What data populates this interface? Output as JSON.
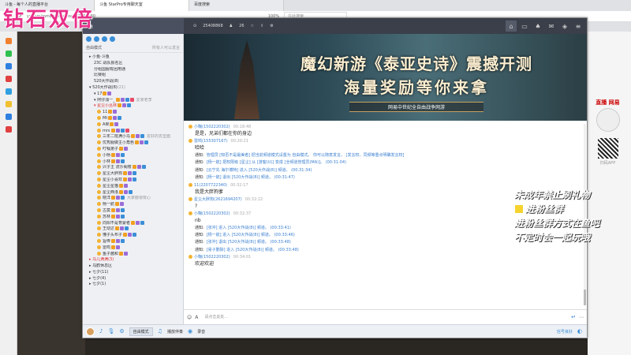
{
  "browser": {
    "tabs": [
      "斗鱼 - 每个人的直播平台",
      "斗鱼 StarPro专用聊天室",
      "百度搜索"
    ],
    "url": "yy.com/mmi/pub/cc/room/2534860",
    "zoom": "100%",
    "search_placeholder": "在此搜索"
  },
  "logo_text": "钻石双倍",
  "app": {
    "room_label": "斗鱼",
    "room_id": "25408868",
    "online_count": "26",
    "titlebar_icons": [
      "home-icon",
      "chat-icon",
      "game-icon",
      "gift-icon",
      "dice-icon",
      "menu-icon"
    ]
  },
  "sidebar": {
    "mode_label": "自由模式",
    "mode_right": "所有人可以发言",
    "channels": [
      {
        "text": "▸ 小鱼·斗鱼",
        "level": 1
      },
      {
        "text": "23C 战队报名区",
        "level": 2
      },
      {
        "text": "分组国服有团用通",
        "level": 2
      },
      {
        "text": "比赛组",
        "level": 2
      },
      {
        "text": "520大作战(8)",
        "level": 2
      },
      {
        "text": "▾ 520大作战(8)",
        "level": 1,
        "count": "(21)"
      },
      {
        "text": "▾ 17",
        "level": 2,
        "tags": 2
      },
      {
        "text": "▾ 阿仔浊一_",
        "level": 2,
        "tags": 4,
        "suffix": "友家老李"
      },
      {
        "text": "▾ 星尘小丛林",
        "level": 2,
        "tags": 3,
        "red": true
      },
      {
        "text": "11",
        "level": 3,
        "tags": 2
      },
      {
        "text": "Mt",
        "level": 3,
        "tags": 3
      },
      {
        "text": "A果",
        "level": 3,
        "tags": 2
      },
      {
        "text": "mrs",
        "level": 3,
        "tags": 4
      },
      {
        "text": "三年二班满小马",
        "level": 3,
        "tags": 3,
        "suffix": "友好的去里面"
      },
      {
        "text": "优秀服做主小角色",
        "level": 3,
        "tags": 3
      },
      {
        "text": "叮嘱弟子",
        "level": 3,
        "tags": 2
      },
      {
        "text": "小杨",
        "level": 3,
        "tags": 3
      },
      {
        "text": "小林",
        "level": 3,
        "tags": 3
      },
      {
        "text": "兴子主 流沙阁楼",
        "level": 3,
        "tags": 3
      },
      {
        "text": "星尘大胖狗",
        "level": 3,
        "tags": 3
      },
      {
        "text": "星尘小喜欢",
        "level": 3,
        "tags": 3
      },
      {
        "text": "星尘星猫",
        "level": 3,
        "tags": 2
      },
      {
        "text": "星尘西洛",
        "level": 3,
        "tags": 3
      },
      {
        "text": "晓洋",
        "level": 3,
        "tags": 3,
        "suffix": "大家都很有心"
      },
      {
        "text": "杨一航",
        "level": 3,
        "tags": 2
      },
      {
        "text": "古莫",
        "level": 3,
        "tags": 3
      },
      {
        "text": "苏林",
        "level": 3,
        "tags": 3
      },
      {
        "text": "向阳不是育蒙者",
        "level": 3,
        "tags": 3
      },
      {
        "text": "王动达",
        "level": 3,
        "tags": 3
      },
      {
        "text": "懂子头布子",
        "level": 3,
        "tags": 3
      },
      {
        "text": "旨俸",
        "level": 3,
        "tags": 3
      },
      {
        "text": "雷鸣",
        "level": 3,
        "tags": 2
      },
      {
        "text": "鱼子酱和",
        "level": 3,
        "tags": 2
      },
      {
        "text": "▸ 马儿满满(3)",
        "level": 1,
        "red": true
      },
      {
        "text": "▸ 乌鹤休息区",
        "level": 1
      },
      {
        "text": "▸ 七夕(11)",
        "level": 1
      },
      {
        "text": "▸ 七夕(4)",
        "level": 1
      },
      {
        "text": "▸ 七夕(1)",
        "level": 1
      }
    ]
  },
  "banner": {
    "line1": "魔幻新游《泰亚史诗》震撼开测",
    "line2": "海量奖励等你来拿",
    "line3": "网易中世纪全自由战争网游"
  },
  "chat": {
    "messages": [
      {
        "type": "msg",
        "name": "小鞠(1502220302)",
        "ts": "00:18:48",
        "body": "是是，兄弟们都在你的身边"
      },
      {
        "type": "msg",
        "name": "雷鸣(155307167)",
        "ts": "00:20:21",
        "body": "哈哈"
      },
      {
        "type": "notice",
        "label": "通知:",
        "text": "管理员 [知否不是最美者] 把当前频道模式设置为 自由模式。 你可以随意发言。 [发言权、同频等重点明确发言权]"
      },
      {
        "type": "notice",
        "label": "通知:",
        "text": "[杨一航] 把权限级 [星尘] 从 [游客(U)] 变成 [全频道管理员(MA)]。 (00:31:04)"
      },
      {
        "type": "notice",
        "label": "通知:",
        "text": "[云宁先 海尔博特] 进入 [520大作战(8)] 频道。 (00:31:34)"
      },
      {
        "type": "notice",
        "label": "通知:",
        "text": "[杨一航] 退出 [520大作战(8)] 频道。 (00:31:47)"
      },
      {
        "type": "msg",
        "name": "11(2207722340)",
        "ts": "00:32:17",
        "body": "我是大胖狗爹"
      },
      {
        "type": "msg",
        "name": "星尘大胖狗(2621694207)",
        "ts": "00:32:22",
        "body": "?"
      },
      {
        "type": "msg",
        "name": "小鞠(1502220302)",
        "ts": "00:32:37",
        "body": "nb"
      },
      {
        "type": "notice",
        "label": "通知:",
        "text": "[张冲] 进入 [520大作战(8)] 频道。 (00:33:41)"
      },
      {
        "type": "notice",
        "label": "通知:",
        "text": "[杨一航] 进入 [520大作战(8)] 频道。 (00:33:46)"
      },
      {
        "type": "notice",
        "label": "通知:",
        "text": "[张冲] 退出 [520大作战(8)] 频道。 (00:33:48)"
      },
      {
        "type": "notice",
        "label": "通知:",
        "text": "[易子删除] 进入 [520大作战(8)] 频道。 (00:33:48)"
      },
      {
        "type": "msg",
        "name": "小鞠(1502220302)",
        "ts": "00:34:01",
        "body": "欢迎欢迎"
      }
    ]
  },
  "input": {
    "placeholder": "请点击此处...",
    "send_label": "↵"
  },
  "bottombar": {
    "mode_button": "自由模式",
    "music_label": "播放伴奏",
    "record_label": "录音",
    "signal": "信号良好"
  },
  "right_ad": {
    "title": "直播 网易",
    "caption": "扫码APP"
  },
  "overlay": {
    "line1": "未成年禁止刷礼物",
    "line2": "进粉丝群",
    "line3": "进粉丝群方式在鱼吧",
    "line4": "不定时会一起玩哦"
  }
}
